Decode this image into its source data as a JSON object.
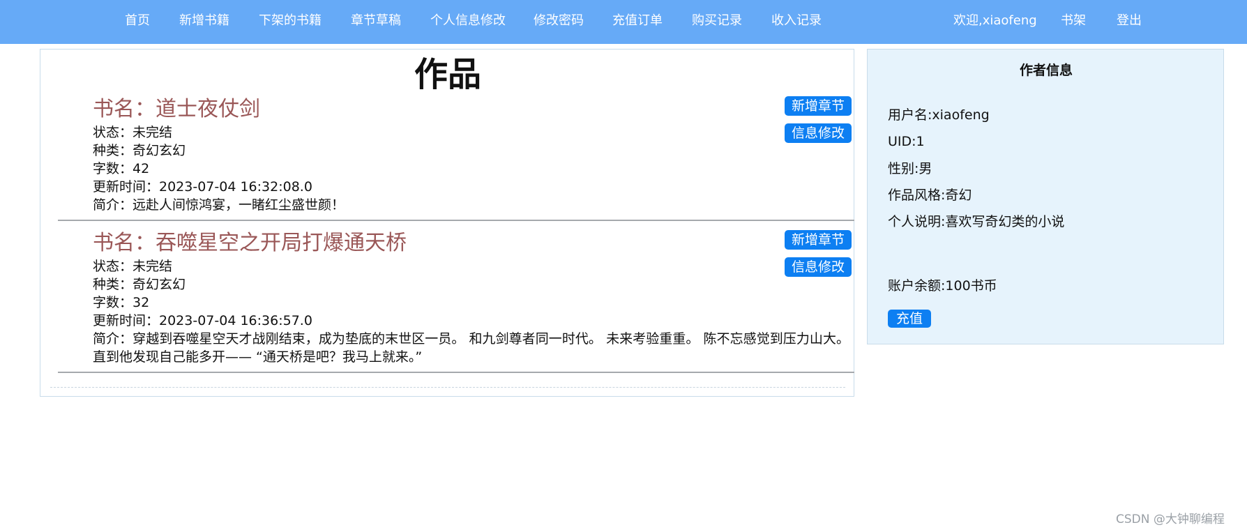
{
  "nav": {
    "items": [
      "首页",
      "新增书籍",
      "下架的书籍",
      "章节草稿",
      "个人信息修改",
      "修改密码",
      "充值订单",
      "购买记录",
      "收入记录"
    ],
    "welcome": "欢迎,xiaofeng",
    "bookshelf": "书架",
    "logout": "登出"
  },
  "works": {
    "title": "作品",
    "books": [
      {
        "title": "书名：道士夜仗剑",
        "status": "状态：未完结",
        "category": "种类：奇幻玄幻",
        "word_count": "字数：42",
        "updated": "更新时间：2023-07-04 16:32:08.0",
        "intro": "简介：远赴人间惊鸿宴，一睹红尘盛世颜！",
        "add_chapter_label": "新增章节",
        "edit_info_label": "信息修改"
      },
      {
        "title": "书名：吞噬星空之开局打爆通天桥",
        "status": "状态：未完结",
        "category": "种类：奇幻玄幻",
        "word_count": "字数：32",
        "updated": "更新时间：2023-07-04 16:36:57.0",
        "intro": "简介：穿越到吞噬星空天才战刚结束，成为垫底的末世区一员。 和九剑尊者同一时代。 未来考验重重。 陈不忘感觉到压力山大。 直到他发现自己能多开—— “通天桥是吧？我马上就来。”",
        "add_chapter_label": "新增章节",
        "edit_info_label": "信息修改"
      }
    ]
  },
  "author": {
    "heading": "作者信息",
    "username": "用户名:xiaofeng",
    "uid": "UID:1",
    "gender": "性别:男",
    "style": "作品风格:奇幻",
    "bio": "个人说明:喜欢写奇幻类的小说",
    "balance": "账户余额:100书币",
    "recharge_label": "充值"
  },
  "watermark": "CSDN @大钟聊编程",
  "colors": {
    "nav_bg": "#66aaf7",
    "button_bg": "#0d7ff2",
    "book_title": "#9a5757",
    "author_panel_bg": "#e6f3fc"
  }
}
